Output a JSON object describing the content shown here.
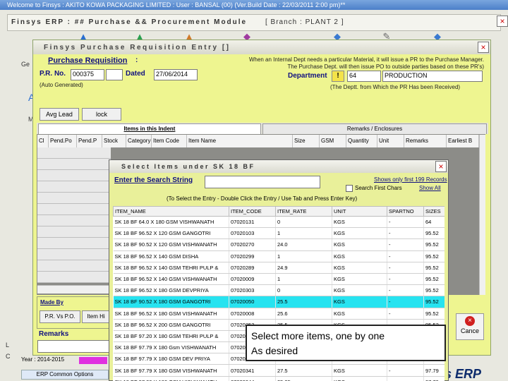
{
  "window": {
    "title": "Welcome to Finsys : AKITO KOWA PACKAGING LIMITED : User : BANSAL (00) (Ver.Build Date : 22/03/2011 2:00 pm)**"
  },
  "module": {
    "title": "Finsys ERP : ## Purchase && Procurement Module",
    "branch": "[ Branch : PLANT 2 ]"
  },
  "left_edge": [
    "Ge",
    "A",
    "M",
    "L",
    "C"
  ],
  "pr_window": {
    "title": "Finsys Purchase Requisition Entry []",
    "heading": "Purchase Requisition",
    "colon": ":",
    "pr_no_label": "P.R. No.",
    "pr_no_value": "000375",
    "auto_note": "(Auto Generated)",
    "dated_label": "Dated",
    "dated_value": "27/06/2014",
    "info_text": "When an Internal Dept needs a particular Material, it will issue a PR to the Purchase Manager. The Purchase Dept. will then issue PO to outside parties based on these PR's)",
    "department_label": "Department",
    "department_code": "64",
    "department_name": "PRODUCTION",
    "department_note": "(The Deptt. from Which the PR Has been Received)",
    "warn_symbol": "!",
    "btn_avg_lead": "Avg Lead",
    "btn_lock": "lock",
    "tabs": [
      "Items in this Indent",
      "Remarks / Enclosures"
    ],
    "grid_columns": [
      "Cl",
      "Pend.Po",
      "Pend.P",
      "Stock",
      "Category",
      "Item Code",
      "Item Name",
      "Size",
      "GSM",
      "Quantity",
      "Unit",
      "Remarks",
      "Earliest B"
    ],
    "made_by_label": "Made By",
    "btn_pr_vs_po": "P.R. Vs P.O.",
    "btn_item_partial": "Item Hi",
    "remarks_label": "Remarks",
    "cancel_label": "Cance",
    "year_label": "Year : 2014-2015",
    "erp_common": "ERP Common Options",
    "brand": "s ERP"
  },
  "popup": {
    "title": "Select Items under SK 18 BF",
    "search_label": "Enter the Search String",
    "search_value": "",
    "shows_first": "Shows only first 199 Records",
    "search_first_chars": "Search First Chars",
    "show_all": "Show All",
    "instructions": "(To Select the Entry - Double Click the Entry / Use Tab and Press Enter Key)",
    "columns": [
      "ITEM_NAME",
      "ITEM_CODE",
      "ITEM_RATE",
      "UNIT",
      "SPARTNO",
      "SIZES"
    ],
    "rows": [
      [
        "SK 18 BF 64.0 X 180 GSM VISHWANATH",
        "07020131",
        "0",
        "KGS",
        "-",
        "64"
      ],
      [
        "SK 18 BF 96.52 X 120 GSM GANGOTRI",
        "07020103",
        "1",
        "KGS",
        "-",
        "95.52"
      ],
      [
        "SK 18 BF 90.52 X 120 GSM VISHWANATH",
        "07020270",
        "24.0",
        "KGS",
        "-",
        "95.52"
      ],
      [
        "SK 18 BF 96.52 X 140 GSM DISHA",
        "07020299",
        "1",
        "KGS",
        "-",
        "95.52"
      ],
      [
        "SK 18 BF 96.52 X 140 GSM TEHRI PULP &",
        "07020289",
        "24.9",
        "KGS",
        "-",
        "95.52"
      ],
      [
        "SK 18 BF 96.52 X 140 GSM VISHWANATH",
        "07020009",
        "1",
        "KGS",
        "-",
        "95.52"
      ],
      [
        "SK 18 BF 96.52 X 180 GSM DEVPRIYA",
        "07020303",
        "0",
        "KGS",
        "-",
        "95.52"
      ],
      [
        "SK 18 BF 90.52 X 180 GSM GANGOTRI",
        "07020050",
        "25.5",
        "KGS",
        "-",
        "95.52"
      ],
      [
        "SK 18 BF 96.52 X 180 GSM VISHWANATH",
        "07020008",
        "25.6",
        "KGS",
        "-",
        "95.52"
      ],
      [
        "SK 18 BF 96.52 X 200 GSM GANGOTRI",
        "07020352",
        "25.5",
        "KGS",
        "-",
        "95.52"
      ],
      [
        "SK 18 BF 97.20 X 180 GSM TEHRI PULP &",
        "07020306",
        "",
        "",
        "",
        ""
      ],
      [
        "SK 18 BF 97.79 X 180 Gsm VISHWANATH",
        "07020",
        "",
        "",
        "",
        ""
      ],
      [
        "SK 18 BF 97.79 X 180 GSM DEV PRIYA",
        "07020",
        "",
        "",
        "",
        ""
      ],
      [
        "SK 18 BF 97.79 X 180 GSM VISHWANATH",
        "07020341",
        "27.5",
        "KGS",
        "-",
        "97.79"
      ],
      [
        "SK 18 BF 97.20 X 180 GSM VISHWANATH",
        "07020344",
        "25.25",
        "KGS",
        "-",
        "97.79"
      ]
    ],
    "selected_row": 7
  },
  "callout": {
    "line1": "Select more items, one by one",
    "line2": "As desired"
  },
  "colors": {
    "form_bg": "#eef590",
    "popup_bg": "#e9f09a",
    "selection": "#27e3f0",
    "label_blue": "#101080"
  }
}
